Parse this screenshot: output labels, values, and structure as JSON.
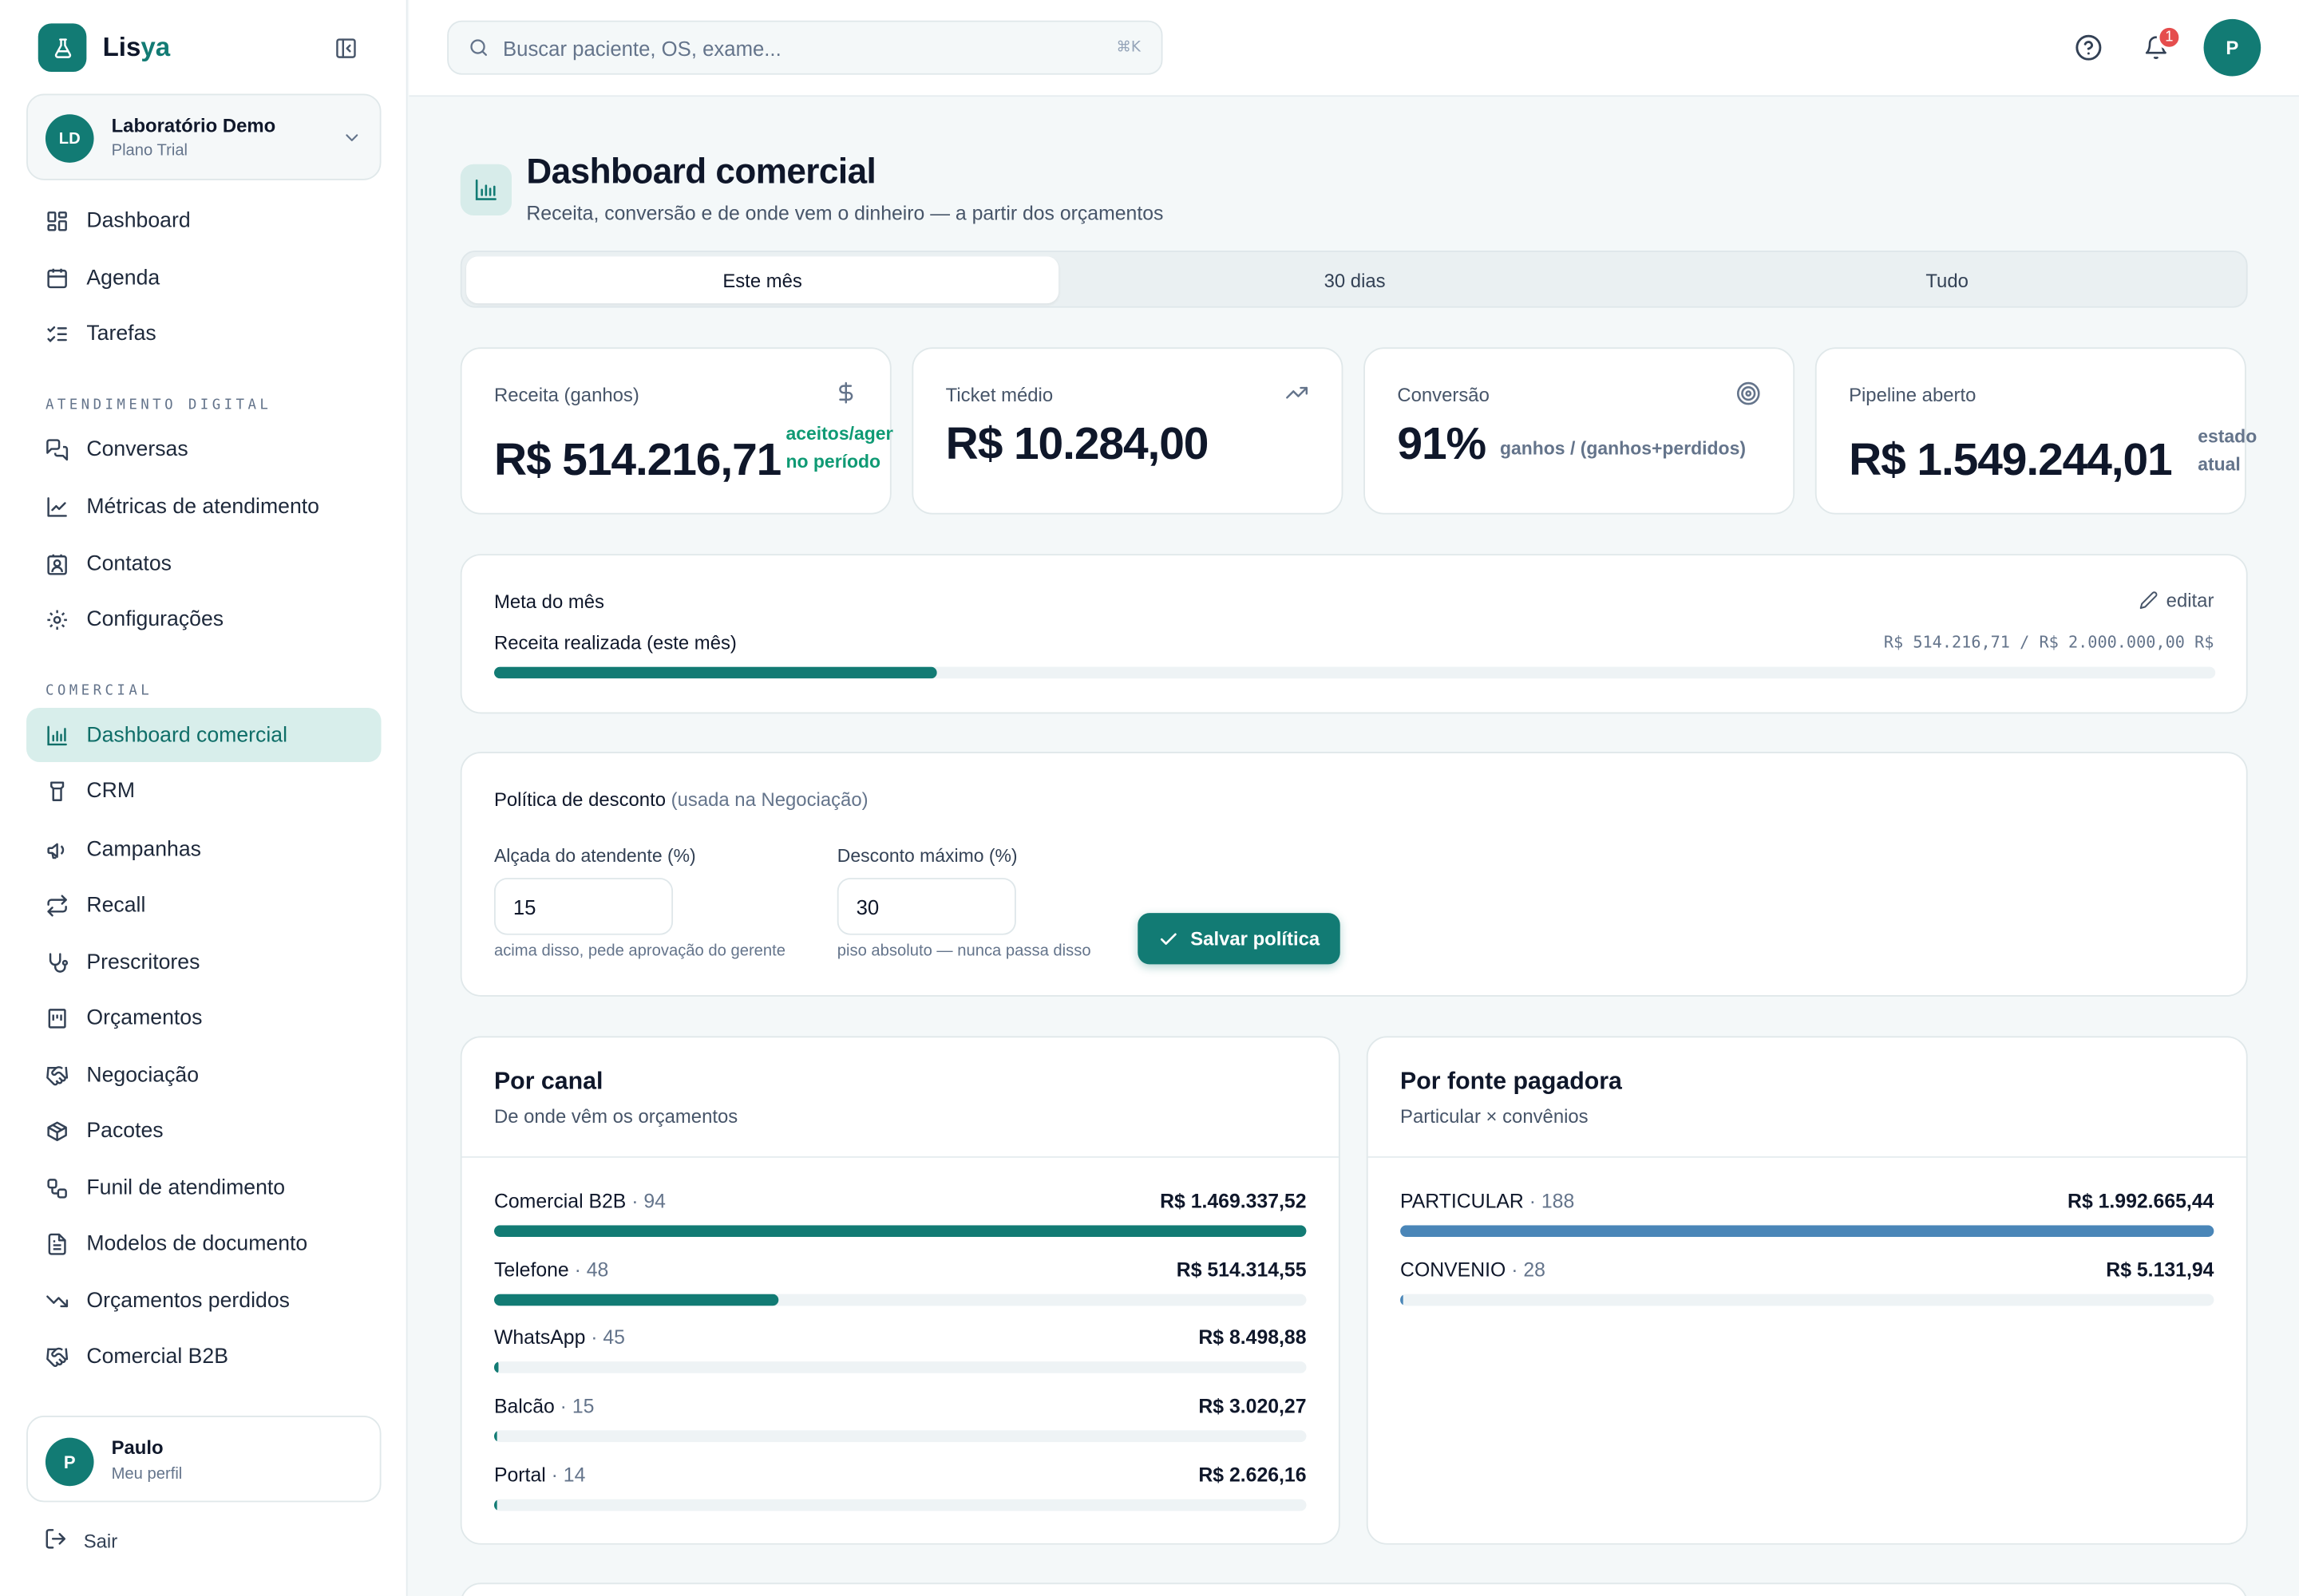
{
  "app": {
    "brand_prefix": "Lis",
    "brand_suffix": "ya"
  },
  "org": {
    "initials": "LD",
    "name": "Laboratório Demo",
    "plan": "Plano Trial"
  },
  "nav": {
    "main": [
      {
        "label": "Dashboard",
        "icon": "layout-dashboard-icon"
      },
      {
        "label": "Agenda",
        "icon": "calendar-icon"
      },
      {
        "label": "Tarefas",
        "icon": "list-checks-icon"
      }
    ],
    "section_digital": "ATENDIMENTO DIGITAL",
    "digital": [
      {
        "label": "Conversas",
        "icon": "messages-icon"
      },
      {
        "label": "Métricas de atendimento",
        "icon": "line-chart-icon"
      },
      {
        "label": "Contatos",
        "icon": "contact-icon"
      },
      {
        "label": "Configurações",
        "icon": "gear-icon"
      }
    ],
    "section_comercial": "COMERCIAL",
    "comercial": [
      {
        "label": "Dashboard comercial",
        "icon": "bar-chart-icon",
        "active": true
      },
      {
        "label": "CRM",
        "icon": "kanban-icon"
      },
      {
        "label": "Campanhas",
        "icon": "megaphone-icon"
      },
      {
        "label": "Recall",
        "icon": "repeat-icon"
      },
      {
        "label": "Prescritores",
        "icon": "stethoscope-icon"
      },
      {
        "label": "Orçamentos",
        "icon": "receipt-icon"
      },
      {
        "label": "Negociação",
        "icon": "handshake-icon"
      },
      {
        "label": "Pacotes",
        "icon": "package-icon"
      },
      {
        "label": "Funil de atendimento",
        "icon": "workflow-icon"
      },
      {
        "label": "Modelos de documento",
        "icon": "file-text-icon"
      },
      {
        "label": "Orçamentos perdidos",
        "icon": "trending-down-icon"
      },
      {
        "label": "Comercial B2B",
        "icon": "handshake-icon"
      }
    ]
  },
  "profile": {
    "initial": "P",
    "name": "Paulo",
    "sub": "Meu perfil",
    "logout": "Sair"
  },
  "topbar": {
    "search_placeholder": "Buscar paciente, OS, exame...",
    "search_shortcut": "⌘K",
    "notifications_count": "1",
    "user_initial": "P"
  },
  "page": {
    "title": "Dashboard comercial",
    "subtitle": "Receita, conversão e de onde vem o dinheiro — a partir dos orçamentos",
    "tabs": [
      "Este mês",
      "30 dias",
      "Tudo"
    ],
    "active_tab": 0
  },
  "kpis": [
    {
      "label": "Receita (ganhos)",
      "value": "R$ 514.216,71",
      "note1": "aceitos/agend",
      "note2": "no período",
      "icon": "dollar-icon"
    },
    {
      "label": "Ticket médio",
      "value": "R$ 10.284,00",
      "icon": "trending-up-icon"
    },
    {
      "label": "Conversão",
      "value": "91%",
      "note": "ganhos / (ganhos+perdidos)",
      "icon": "target-icon"
    },
    {
      "label": "Pipeline aberto",
      "value": "R$ 1.549.244,01",
      "note1": "estado",
      "note2": "atual"
    }
  ],
  "goal": {
    "title": "Meta do mês",
    "edit_label": "editar",
    "row_label": "Receita realizada (este mês)",
    "value_text": "R$ 514.216,71 / R$ 2.000.000,00 R$",
    "progress": 0.2571
  },
  "policy": {
    "title": "Política de desconto",
    "title_note": "(usada na Negociação)",
    "field1_label": "Alçada do atendente (%)",
    "field1_value": "15",
    "field1_hint": "acima disso, pede aprovação do gerente",
    "field2_label": "Desconto máximo (%)",
    "field2_value": "30",
    "field2_hint": "piso absoluto — nunca passa disso",
    "save_label": "Salvar política"
  },
  "by_channel": {
    "title": "Por canal",
    "subtitle": "De onde vêm os orçamentos",
    "rows": [
      {
        "label": "Comercial B2B",
        "count": "94",
        "value": "R$ 1.469.337,52",
        "fraction": 1.0
      },
      {
        "label": "Telefone",
        "count": "48",
        "value": "R$ 514.314,55",
        "fraction": 0.35
      },
      {
        "label": "WhatsApp",
        "count": "45",
        "value": "R$ 8.498,88",
        "fraction": 0.006
      },
      {
        "label": "Balcão",
        "count": "15",
        "value": "R$ 3.020,27",
        "fraction": 0.002
      },
      {
        "label": "Portal",
        "count": "14",
        "value": "R$ 2.626,16",
        "fraction": 0.002
      }
    ],
    "bar_color": "#127b74"
  },
  "by_payer": {
    "title": "Por fonte pagadora",
    "subtitle": "Particular × convênios",
    "rows": [
      {
        "label": "PARTICULAR",
        "count": "188",
        "value": "R$ 1.992.665,44",
        "fraction": 1.0
      },
      {
        "label": "CONVENIO",
        "count": "28",
        "value": "R$ 5.131,94",
        "fraction": 0.003
      }
    ],
    "bar_color": "#4a86b8"
  },
  "colors": {
    "accent": "#127b74",
    "accent_light": "#d8eeeb",
    "success_text": "#0f9a74",
    "badge": "#e54d4d"
  }
}
